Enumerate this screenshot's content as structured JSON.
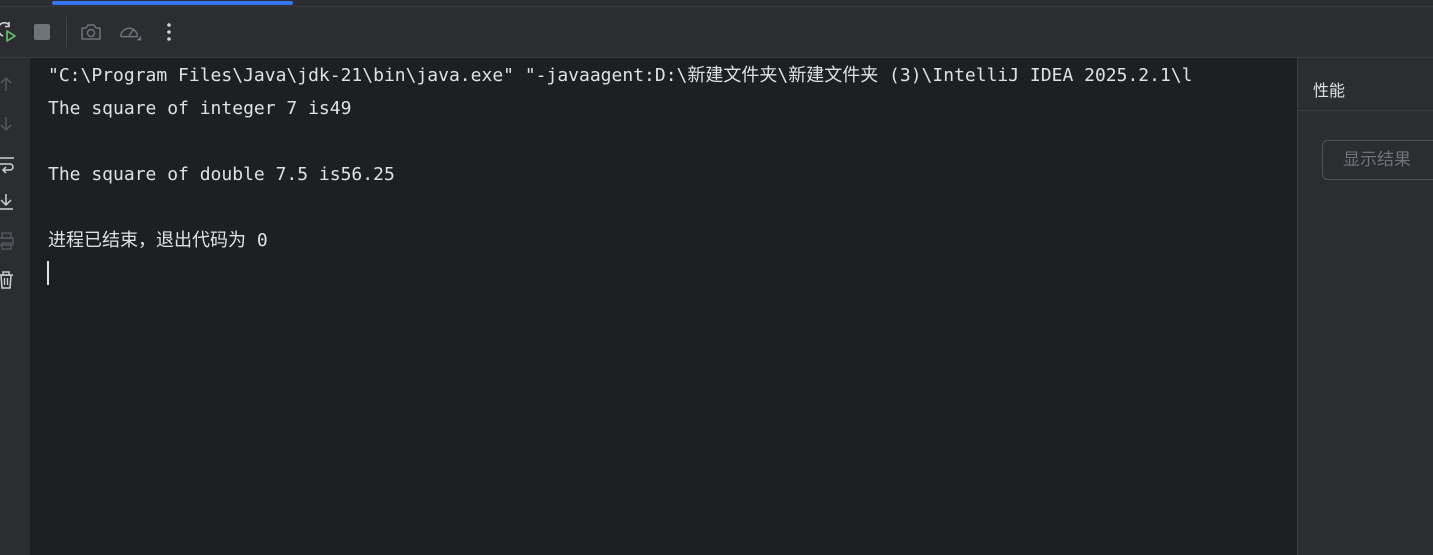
{
  "toolbar": {
    "buttons": [
      {
        "name": "rerun",
        "icon": "rerun-icon"
      },
      {
        "name": "stop",
        "icon": "stop-icon"
      },
      {
        "name": "screenshot",
        "icon": "camera-icon"
      },
      {
        "name": "profiler",
        "icon": "speedometer-icon"
      },
      {
        "name": "more",
        "icon": "more-vertical-icon"
      }
    ]
  },
  "gutter": {
    "buttons": [
      {
        "name": "up",
        "icon": "arrow-up-icon"
      },
      {
        "name": "down",
        "icon": "arrow-down-icon"
      },
      {
        "name": "soft-wrap",
        "icon": "soft-wrap-icon"
      },
      {
        "name": "scroll-to-end",
        "icon": "scroll-to-end-icon"
      },
      {
        "name": "print",
        "icon": "print-icon"
      },
      {
        "name": "clear",
        "icon": "trash-icon"
      }
    ]
  },
  "console": {
    "lines": [
      "\"C:\\Program Files\\Java\\jdk-21\\bin\\java.exe\" \"-javaagent:D:\\新建文件夹\\新建文件夹 (3)\\IntelliJ IDEA 2025.2.1\\l",
      "The square of integer 7 is49",
      "The square of double 7.5 is56.25",
      "进程已结束，退出代码为 0"
    ]
  },
  "right_panel": {
    "title": "性能",
    "show_results_label": "显示结果"
  },
  "colors": {
    "background": "#1e1f22",
    "panel": "#2b2d30",
    "text": "#dfe1e5",
    "accent": "#3574f0",
    "run_green": "#5fb865"
  }
}
